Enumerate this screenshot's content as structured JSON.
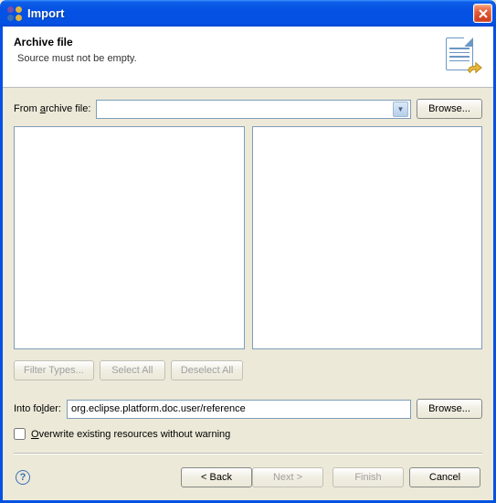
{
  "window": {
    "title": "Import"
  },
  "banner": {
    "title": "Archive file",
    "message": "Source must not be empty."
  },
  "form": {
    "from_label": "From archive file:",
    "from_value": "",
    "browse_from": "Browse...",
    "filter_types": "Filter Types...",
    "select_all": "Select All",
    "deselect_all": "Deselect All",
    "into_label": "Into folder:",
    "into_value": "org.eclipse.platform.doc.user/reference",
    "browse_into": "Browse...",
    "overwrite_label": "Overwrite existing resources without warning",
    "overwrite_checked": false
  },
  "footer": {
    "back": "< Back",
    "next": "Next >",
    "finish": "Finish",
    "cancel": "Cancel"
  }
}
